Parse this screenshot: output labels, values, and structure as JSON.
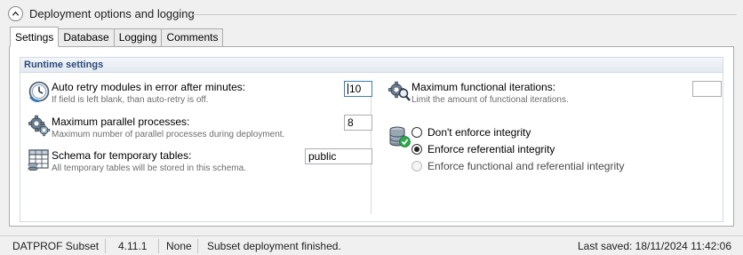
{
  "section": {
    "title": "Deployment options and logging",
    "collapse_icon": "chevron-up-icon"
  },
  "tabs": [
    {
      "label": "Settings",
      "active": true
    },
    {
      "label": "Database",
      "active": false
    },
    {
      "label": "Logging",
      "active": false
    },
    {
      "label": "Comments",
      "active": false
    }
  ],
  "runtime": {
    "header": "Runtime settings",
    "auto_retry": {
      "label": "Auto retry modules in error after minutes:",
      "description": "If field is left blank, than auto-retry is off.",
      "value": "10",
      "icon": "clock-retry-icon"
    },
    "max_parallel": {
      "label": "Maximum parallel processes:",
      "description": "Maximum number of parallel processes during deployment.",
      "value": "8",
      "icon": "gears-icon"
    },
    "schema": {
      "label": "Schema for temporary tables:",
      "description": "All temporary tables will be stored in this schema.",
      "value": "public",
      "icon": "table-icon"
    },
    "max_functional": {
      "label": "Maximum functional iterations:",
      "description": "Limit the amount of functional iterations.",
      "value": "",
      "icon": "gear-search-icon"
    },
    "integrity": {
      "icon": "database-check-icon",
      "options": [
        {
          "label": "Don't enforce integrity",
          "checked": false,
          "enabled": true
        },
        {
          "label": "Enforce referential integrity",
          "checked": true,
          "enabled": true
        },
        {
          "label": "Enforce functional and referential integrity",
          "checked": false,
          "enabled": false
        }
      ]
    }
  },
  "status": {
    "product": "DATPROF Subset",
    "version": "4.11.1",
    "connection": "None",
    "message": "Subset deployment finished.",
    "last_saved": "Last saved: 18/11/2024 11:42:06"
  },
  "colors": {
    "group_header_text": "#2c4b7a",
    "accent_blue": "#3c7fb1",
    "check_green": "#2fa84f"
  }
}
